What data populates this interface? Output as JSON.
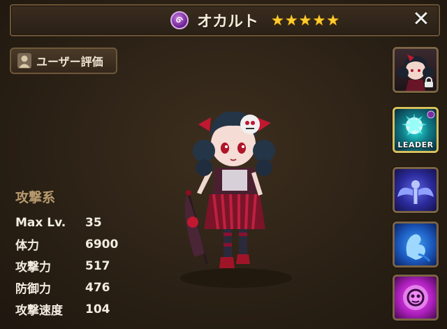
{
  "header": {
    "element_icon": "dark-element-icon",
    "title": "オカルト",
    "stars": [
      "★",
      "★",
      "★",
      "★",
      "★"
    ],
    "close_label": "✕"
  },
  "review_button": {
    "icon": "user-icon",
    "label": "ユーザー評価"
  },
  "stats": {
    "category": "攻撃系",
    "rows": [
      {
        "label": "Max Lv.",
        "value": "35"
      },
      {
        "label": "体力",
        "value": "6900"
      },
      {
        "label": "攻撃力",
        "value": "517"
      },
      {
        "label": "防御力",
        "value": "476"
      },
      {
        "label": "攻撃速度",
        "value": "104"
      }
    ]
  },
  "sidebar": {
    "portrait_icon": "monster-portrait",
    "lock_icon": "lock-icon",
    "leader_label": "LEADER",
    "skills": [
      "leader-skill-icon",
      "wings-skill-icon",
      "hand-skill-icon",
      "curse-skill-icon"
    ]
  },
  "colors": {
    "star": "#ffcc2e",
    "stat_category": "#b89a6e",
    "dark_element": "#7a2fa0",
    "leader_border": "#d8c05a"
  }
}
